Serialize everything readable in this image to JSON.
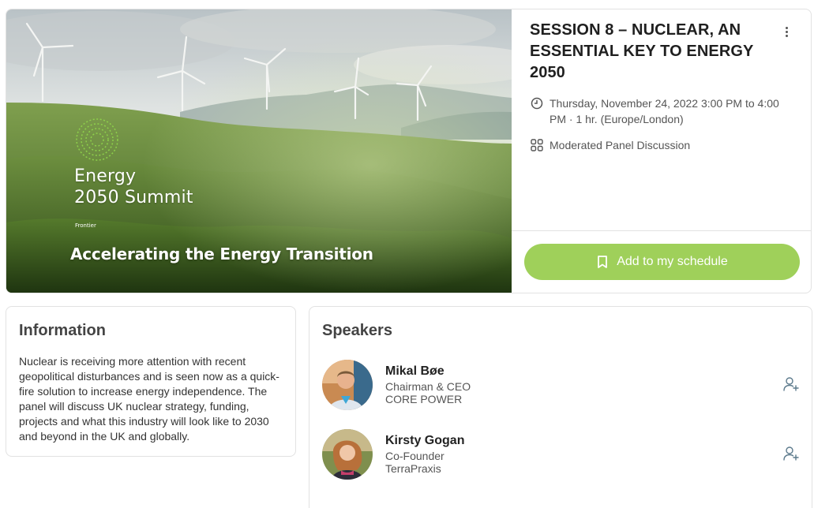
{
  "banner": {
    "logo_title_line1": "Energy",
    "logo_title_line2": "2050 Summit",
    "brand": "Frontier",
    "tagline": "Accelerating the Energy Transition"
  },
  "session": {
    "title": "SESSION 8 – NUCLEAR, AN ESSENTIAL KEY TO ENERGY 2050",
    "datetime": "Thursday, November 24, 2022 3:00 PM to 4:00 PM · 1 hr. (Europe/London)",
    "format": "Moderated Panel Discussion",
    "schedule_button_label": "Add to my schedule",
    "accent_color": "#9fd05a"
  },
  "information": {
    "heading": "Information",
    "body": "Nuclear is receiving more attention with recent geopolitical disturbances and is seen now as a quick-fire solution to increase energy independence. The panel will discuss UK nuclear strategy, funding, projects and what this industry will look like to 2030 and beyond in the UK and globally."
  },
  "speakers": {
    "heading": "Speakers",
    "items": [
      {
        "name": "Mikal Bøe",
        "role": "Chairman & CEO",
        "organization": "CORE POWER"
      },
      {
        "name": "Kirsty Gogan",
        "role": "Co-Founder",
        "organization": "TerraPraxis"
      }
    ]
  },
  "icons": {
    "menu": "kebab-menu-icon",
    "time": "clock-icon",
    "format": "grid-icon",
    "schedule": "bookmark-icon",
    "add_contact": "add-user-icon"
  }
}
